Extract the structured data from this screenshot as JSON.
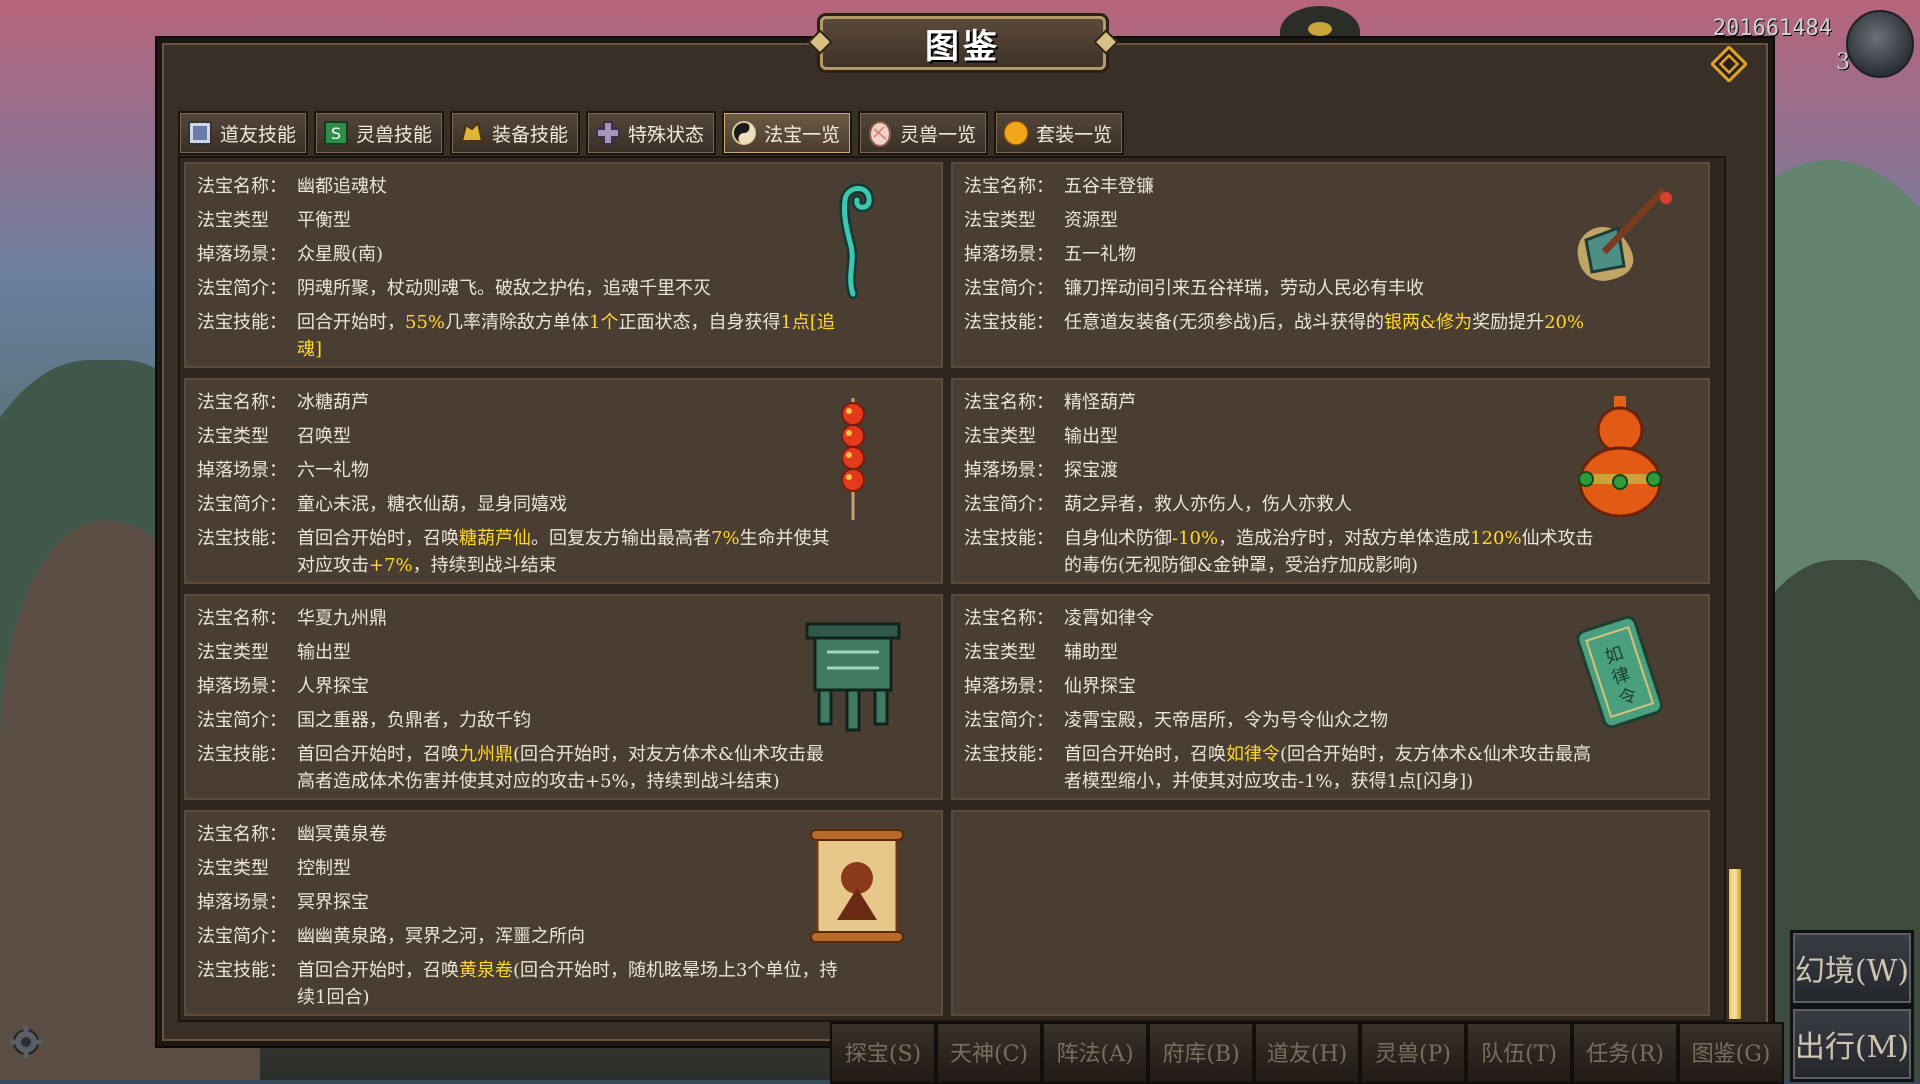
{
  "header": {
    "title": "图鉴",
    "player_id": "201661484",
    "player_level": "3"
  },
  "tabs": [
    {
      "label": "道友技能",
      "icon": "scroll-book-icon"
    },
    {
      "label": "灵兽技能",
      "icon": "green-scroll-icon"
    },
    {
      "label": "装备技能",
      "icon": "golden-helmet-icon"
    },
    {
      "label": "特殊状态",
      "icon": "purple-cross-icon"
    },
    {
      "label": "法宝一览",
      "icon": "yinyang-icon"
    },
    {
      "label": "灵兽一览",
      "icon": "spirit-egg-icon"
    },
    {
      "label": "套装一览",
      "icon": "gold-orb-icon"
    }
  ],
  "labels": {
    "name": "法宝名称：",
    "type": "法宝类型",
    "drop": "掉落场景：",
    "intro": "法宝简介：",
    "skill": "法宝技能："
  },
  "treasures": [
    {
      "name": "幽都追魂杖",
      "type": "平衡型",
      "drop": "众星殿(南)",
      "intro": "阴魂所聚，杖动则魂飞。破敌之护佑，追魂千里不灭",
      "skill_parts": [
        [
          "回合开始时，",
          false
        ],
        [
          "55%",
          true
        ],
        [
          "几率清除敌方单体",
          false
        ],
        [
          "1个",
          true
        ],
        [
          "正面状态，自身获得",
          false
        ],
        [
          "1点[追魂]",
          true
        ]
      ],
      "art": "jade-staff-icon"
    },
    {
      "name": "五谷丰登镰",
      "type": "资源型",
      "drop": "五一礼物",
      "intro": "镰刀挥动间引来五谷祥瑞，劳动人民必有丰收",
      "skill_parts": [
        [
          "任意道友装备(无须参战)后，战斗获得的",
          false
        ],
        [
          "银两&修为",
          true
        ],
        [
          "奖励提升",
          false
        ],
        [
          "20%",
          true
        ]
      ],
      "art": "flaming-sickle-icon"
    },
    {
      "name": "冰糖葫芦",
      "type": "召唤型",
      "drop": "六一礼物",
      "intro": "童心未泯，糖衣仙葫，显身同嬉戏",
      "skill_parts": [
        [
          "首回合开始时，召唤",
          false
        ],
        [
          "糖葫芦仙",
          true
        ],
        [
          "。回复友方输出最高者",
          false
        ],
        [
          "7%",
          true
        ],
        [
          "生命并使其对应攻击",
          false
        ],
        [
          "+7%",
          true
        ],
        [
          "，持续到战斗结束",
          false
        ]
      ],
      "art": "candied-haws-icon"
    },
    {
      "name": "精怪葫芦",
      "type": "输出型",
      "drop": "探宝渡",
      "intro": "葫之异者，救人亦伤人，伤人亦救人",
      "skill_parts": [
        [
          "自身仙术防御",
          false
        ],
        [
          "-10%",
          true
        ],
        [
          "，造成治疗时，对敌方单体造成",
          false
        ],
        [
          "120%",
          true
        ],
        [
          "仙术攻击的毒伤(无视防御&金钟罩，受治疗加成影响)",
          false
        ]
      ],
      "art": "red-gourd-icon"
    },
    {
      "name": "华夏九州鼎",
      "type": "输出型",
      "drop": "人界探宝",
      "intro": "国之重器，负鼎者，力敌千钧",
      "skill_parts": [
        [
          "首回合开始时，召唤",
          false
        ],
        [
          "九州鼎",
          true
        ],
        [
          "(回合开始时，对友方体术&仙术攻击最高者造成体术伤害并使其对应的攻击+5%，持续到战斗结束)",
          false
        ]
      ],
      "art": "bronze-cauldron-icon"
    },
    {
      "name": "凌霄如律令",
      "type": "辅助型",
      "drop": "仙界探宝",
      "intro": "凌霄宝殿，天帝居所，令为号令仙众之物",
      "skill_parts": [
        [
          "首回合开始时，召唤",
          false
        ],
        [
          "如律令",
          true
        ],
        [
          "(回合开始时，友方体术&仙术攻击最高者模型缩小，并使其对应攻击-1%，获得1点[闪身])",
          false
        ]
      ],
      "art": "jade-command-token-icon",
      "art_text": "如律令"
    },
    {
      "name": "幽冥黄泉卷",
      "type": "控制型",
      "drop": "冥界探宝",
      "intro": "幽幽黄泉路，冥界之河，浑噩之所向",
      "skill_parts": [
        [
          "首回合开始时，召唤",
          false
        ],
        [
          "黄泉卷",
          true
        ],
        [
          "(回合开始时，随机眩晕场上3个单位，持续1回合)",
          false
        ]
      ],
      "art": "underworld-scroll-icon"
    }
  ],
  "side_buttons": [
    {
      "label": "幻境(W)"
    },
    {
      "label": "出行(M)"
    }
  ],
  "bottom_menu": [
    "探宝(S)",
    "天神(C)",
    "阵法(A)",
    "府库(B)",
    "道友(H)",
    "灵兽(P)",
    "队伍(T)",
    "任务(R)",
    "图鉴(G)"
  ],
  "colors": {
    "highlight": "#ffd82b",
    "text": "#ece6d6",
    "card_bg": "#4a3d32",
    "panel_bg": "#3a2f26"
  }
}
